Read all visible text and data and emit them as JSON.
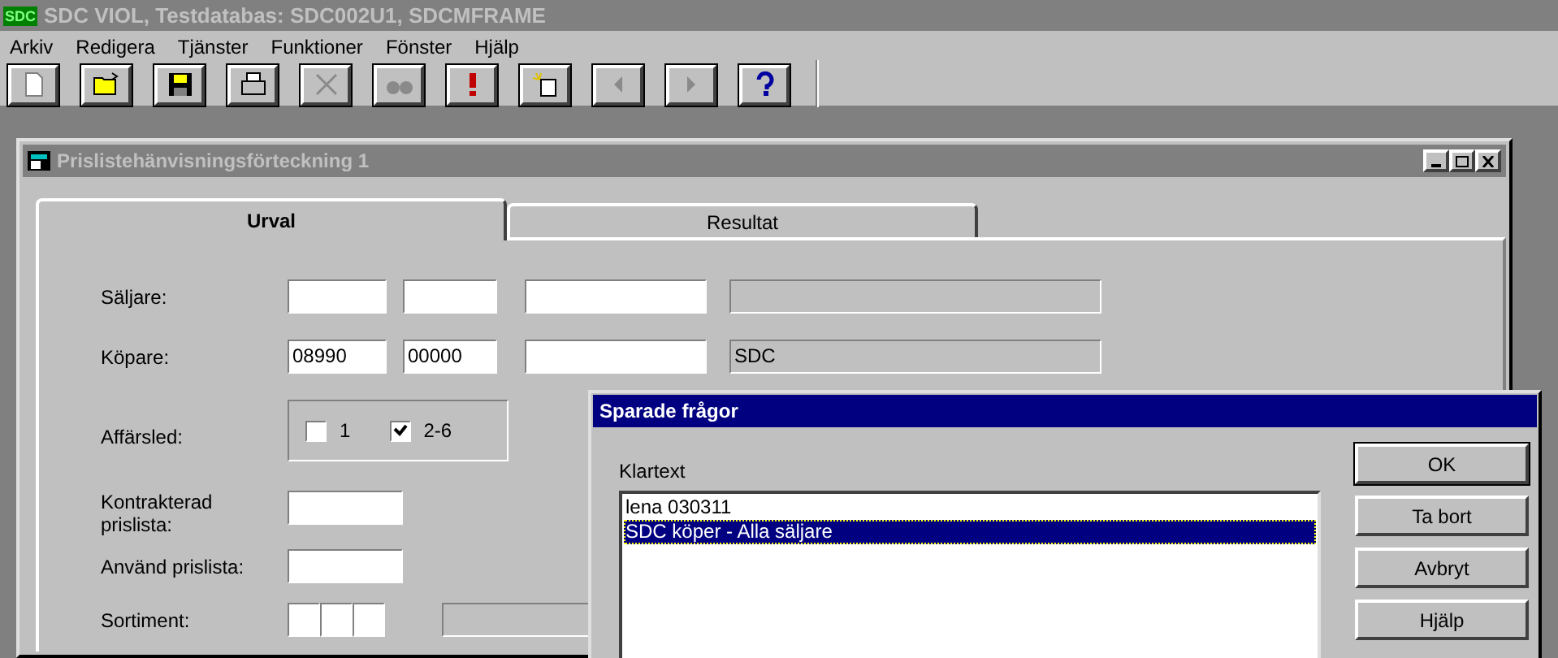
{
  "app": {
    "logo": "SDC",
    "title": "SDC VIOL, Testdatabas: SDC002U1, SDCMFRAME"
  },
  "menu": [
    "Arkiv",
    "Redigera",
    "Tjänster",
    "Funktioner",
    "Fönster",
    "Hjälp"
  ],
  "toolbar": [
    {
      "kind": "new",
      "disabled": false
    },
    {
      "kind": "open",
      "disabled": false
    },
    {
      "kind": "save",
      "disabled": false
    },
    {
      "kind": "print",
      "disabled": false
    },
    {
      "kind": "delete",
      "disabled": true
    },
    {
      "kind": "find",
      "disabled": true
    },
    {
      "kind": "alert",
      "disabled": false
    },
    {
      "kind": "paste",
      "disabled": false
    },
    {
      "kind": "prev",
      "disabled": true
    },
    {
      "kind": "next",
      "disabled": true
    },
    {
      "kind": "help",
      "disabled": false
    }
  ],
  "child_window": {
    "title": "Prislistehänvisningsförteckning 1"
  },
  "tabs": [
    {
      "label": "Urval",
      "selected": true
    },
    {
      "label": "Resultat",
      "selected": false
    }
  ],
  "form": {
    "saljare": {
      "label": "Säljare:"
    },
    "kopare": {
      "label": "Köpare:",
      "code": "08990",
      "sub_code": "00000",
      "description": "SDC"
    },
    "affarsled": {
      "label": "Affärsled:",
      "options": [
        {
          "label": "1",
          "checked": false
        },
        {
          "label": "2-6",
          "checked": true
        }
      ]
    },
    "kontrakterad": {
      "label": "Kontrakterad prislista:"
    },
    "anvand": {
      "label": "Använd prislista:"
    },
    "sortiment": {
      "label": "Sortiment:"
    }
  },
  "dialog": {
    "title": "Sparade frågor",
    "list_label": "Klartext",
    "items": [
      {
        "text": "lena 030311",
        "selected": false
      },
      {
        "text": "SDC köper - Alla säljare",
        "selected": true
      }
    ],
    "buttons": [
      "OK",
      "Ta bort",
      "Avbryt",
      "Hjälp"
    ]
  }
}
